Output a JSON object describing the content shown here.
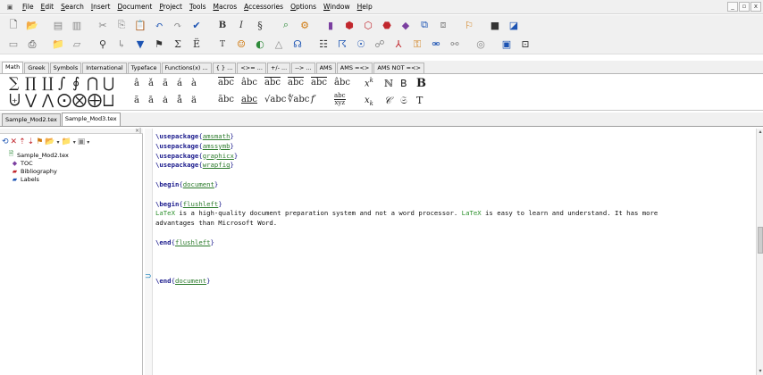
{
  "menu": {
    "items": [
      {
        "label": "File",
        "key": "F",
        "rest": "ile"
      },
      {
        "label": "Edit",
        "key": "E",
        "rest": "dit"
      },
      {
        "label": "Search",
        "key": "S",
        "rest": "earch"
      },
      {
        "label": "Insert",
        "key": "I",
        "rest": "nsert"
      },
      {
        "label": "Document",
        "key": "D",
        "rest": "ocument"
      },
      {
        "label": "Project",
        "key": "P",
        "rest": "roject"
      },
      {
        "label": "Tools",
        "key": "T",
        "rest": "ools"
      },
      {
        "label": "Macros",
        "key": "M",
        "rest": "acros"
      },
      {
        "label": "Accessories",
        "key": "A",
        "rest": "ccessories"
      },
      {
        "label": "Options",
        "key": "O",
        "rest": "ptions"
      },
      {
        "label": "Window",
        "key": "W",
        "rest": "indow"
      },
      {
        "label": "Help",
        "key": "H",
        "rest": "elp"
      }
    ],
    "window_controls": [
      "_",
      "▫",
      "x"
    ]
  },
  "symbol_tabs": [
    "Math",
    "Greek",
    "Symbols",
    "International",
    "Typeface",
    "Functions(x) ...",
    "{ } ...",
    "<>= ...",
    "+/- ...",
    "--> ...",
    "AMS",
    "AMS =<>",
    "AMS NOT =<>"
  ],
  "active_symbol_tab": "Math",
  "document_tabs": [
    "Sample_Mod2.tex",
    "Sample_Mod3.tex"
  ],
  "active_document_tab": "Sample_Mod3.tex",
  "structure_tree": [
    {
      "label": "Sample_Mod2.tex",
      "icon": "tex-file-icon",
      "level": 0
    },
    {
      "label": "TOC",
      "icon": "toc-icon",
      "level": 1
    },
    {
      "label": "Bibliography",
      "icon": "bibliography-icon",
      "level": 1
    },
    {
      "label": "Labels",
      "icon": "labels-icon",
      "level": 1
    }
  ],
  "editor": {
    "lines": [
      "\\usepackage{amsmath}",
      "\\usepackage{amssymb}",
      "\\usepackage{graphicx}",
      "\\usepackage{wrapfig}",
      "",
      "\\begin{document}",
      "",
      "\\begin{flushleft}",
      "LaTeX is a high-quality document preparation system and not a word processor. LaTeX is easy to learn and understand. It has more",
      "advantages than Microsoft Word.",
      "",
      "\\end{flushleft}",
      "",
      "",
      "",
      "\\end{document}"
    ]
  },
  "colors": {
    "keyword": "#1a1a8c",
    "argument": "#2b7a2b",
    "latex_word": "#2b8f2b",
    "chrome": "#f0f0f0"
  }
}
